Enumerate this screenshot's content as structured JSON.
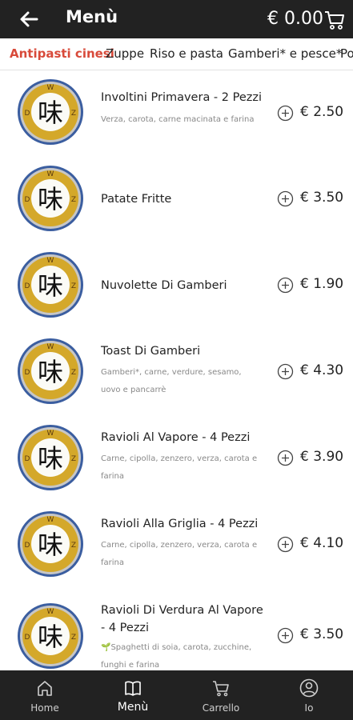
{
  "header": {
    "title": "Menù",
    "total": "€ 0.00",
    "back_icon": "arrow-left-icon",
    "cart_icon": "cart-icon"
  },
  "tabs": [
    {
      "label": "Antipasti cinesi",
      "active": true
    },
    {
      "label": "Zuppe",
      "active": false
    },
    {
      "label": "Riso e pasta",
      "active": false
    },
    {
      "label": "Gamberi* e pesce*",
      "active": false
    },
    {
      "label": "Po",
      "active": false
    }
  ],
  "items": [
    {
      "name": "Involtini Primavera - 2 Pezzi",
      "desc": "Verza, carota, carne macinata e farina",
      "price": "€ 2.50"
    },
    {
      "name": "Patate Fritte",
      "desc": "",
      "price": "€ 3.50"
    },
    {
      "name": "Nuvolette Di Gamberi",
      "desc": "",
      "price": "€ 1.90"
    },
    {
      "name": "Toast Di Gamberi",
      "desc": "Gamberi*, carne, verdure, sesamo, uovo e pancarrè",
      "price": "€ 4.30"
    },
    {
      "name": "Ravioli Al Vapore - 4 Pezzi",
      "desc": "Carne, cipolla, zenzero, verza, carota e farina",
      "price": "€ 3.90"
    },
    {
      "name": "Ravioli Alla Griglia - 4 Pezzi",
      "desc": "Carne, cipolla, zenzero, verza, carota e farina",
      "price": "€ 4.10"
    },
    {
      "name": "Ravioli Di Verdura Al Vapore - 4 Pezzi",
      "desc": "🌱Spaghetti di soia, carota, zucchine, funghi e farina",
      "price": "€ 3.50"
    }
  ],
  "logo": {
    "char": "味",
    "letters": [
      "W",
      "D",
      "Z"
    ]
  },
  "nav": [
    {
      "label": "Home",
      "icon": "home-icon",
      "active": false
    },
    {
      "label": "Menù",
      "icon": "book-icon",
      "active": true
    },
    {
      "label": "Carrello",
      "icon": "cart-icon",
      "active": false
    },
    {
      "label": "Io",
      "icon": "user-icon",
      "active": false
    }
  ],
  "colors": {
    "bar": "#222222",
    "accent": "#d84a3a",
    "logo_gold": "#d4a82a",
    "logo_ring": "#3b5ea0"
  }
}
